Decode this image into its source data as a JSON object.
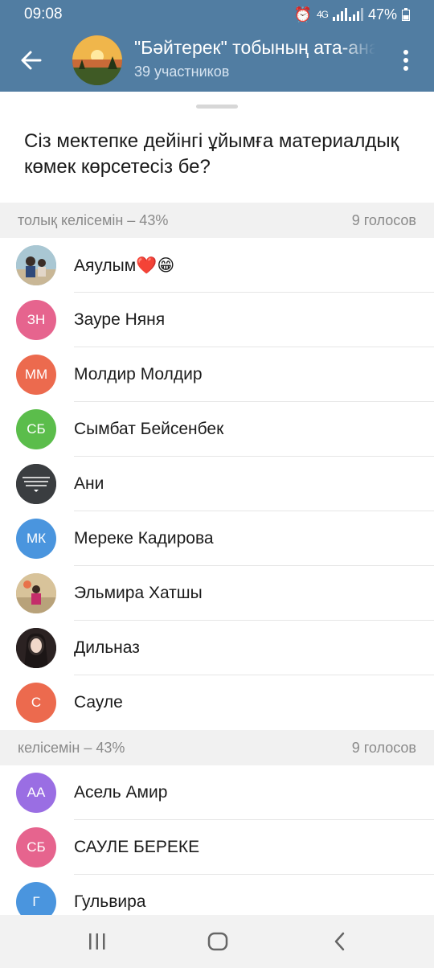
{
  "status": {
    "time": "09:08",
    "network": "4G",
    "battery": "47%"
  },
  "header": {
    "title": "\"Бәйтерек\" тобының ата-аналары",
    "subtitle": "39 участников"
  },
  "question": "Сіз мектепке дейінгі ұйымға материалдық көмек көрсетесіз бе?",
  "sections": [
    {
      "label": "толық келісемін – 43%",
      "votes": "9 голосов",
      "voters": [
        {
          "initials": "",
          "name": "Аяулым❤️😁",
          "color": "#7a9aa8",
          "photo": true
        },
        {
          "initials": "ЗН",
          "name": "Зауре Няня",
          "color": "#e6648e"
        },
        {
          "initials": "ММ",
          "name": "Молдир Молдир",
          "color": "#ec6a4e"
        },
        {
          "initials": "СБ",
          "name": "Сымбат Бейсенбек",
          "color": "#5bbd4b"
        },
        {
          "initials": "",
          "name": "Ани",
          "color": "#3c3c3c",
          "photo": true
        },
        {
          "initials": "МК",
          "name": "Мереке Кадирова",
          "color": "#4a95de"
        },
        {
          "initials": "",
          "name": "Эльмира Хатшы",
          "color": "#c9a77a",
          "photo": true
        },
        {
          "initials": "",
          "name": "Дильназ",
          "color": "#2b2222",
          "photo": true
        },
        {
          "initials": "С",
          "name": "Сауле",
          "color": "#ec6a4e"
        }
      ]
    },
    {
      "label": "келісемін – 43%",
      "votes": "9 голосов",
      "voters": [
        {
          "initials": "АА",
          "name": "Асель Амир",
          "color": "#9a6ee3"
        },
        {
          "initials": "СБ",
          "name": "САУЛЕ БЕРЕКЕ",
          "color": "#e6648e"
        },
        {
          "initials": "Г",
          "name": "Гульвира",
          "color": "#4a95de"
        }
      ]
    }
  ]
}
